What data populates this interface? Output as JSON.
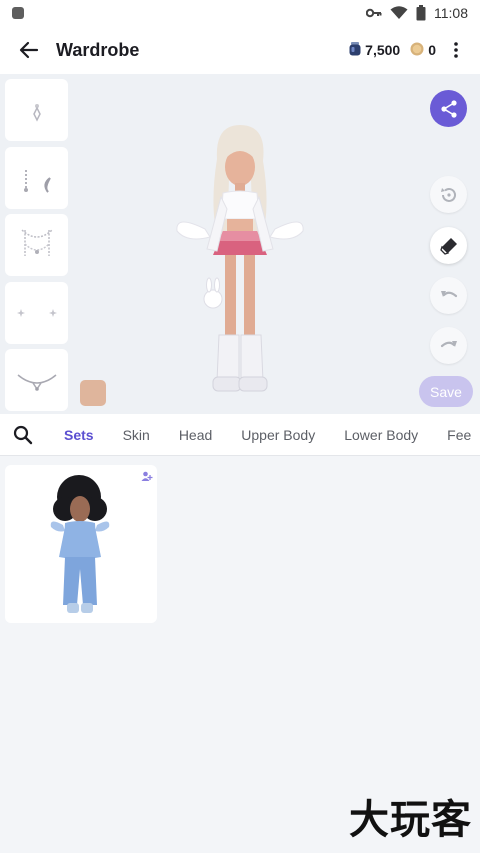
{
  "status_bar": {
    "time": "11:08",
    "icons": [
      "app-indicator-icon",
      "key-icon",
      "wifi-icon",
      "battery-icon"
    ]
  },
  "app_bar": {
    "title": "Wardrobe",
    "gems": "7,500",
    "coins": "0",
    "icons": [
      "back-arrow-icon",
      "gem-icon",
      "coin-icon",
      "more-vert-icon"
    ]
  },
  "preview": {
    "accessory_slots": [
      "earring-slot",
      "ear-cuff-slot",
      "chain-necklace-slot",
      "face-sparkle-slot",
      "choker-slot"
    ],
    "save_label": "Save",
    "skin_color": "#dfb59c",
    "accent_color": "#6a5bd6",
    "actions": [
      "share-icon",
      "reset-icon",
      "eraser-icon",
      "undo-icon",
      "redo-icon"
    ]
  },
  "tabs": [
    "Sets",
    "Skin",
    "Head",
    "Upper Body",
    "Lower Body",
    "Fee"
  ],
  "active_tab": "Sets",
  "sets": [
    {
      "name": "set-card",
      "badge_icon": "person-badge-icon"
    }
  ],
  "watermark": "大玩客"
}
